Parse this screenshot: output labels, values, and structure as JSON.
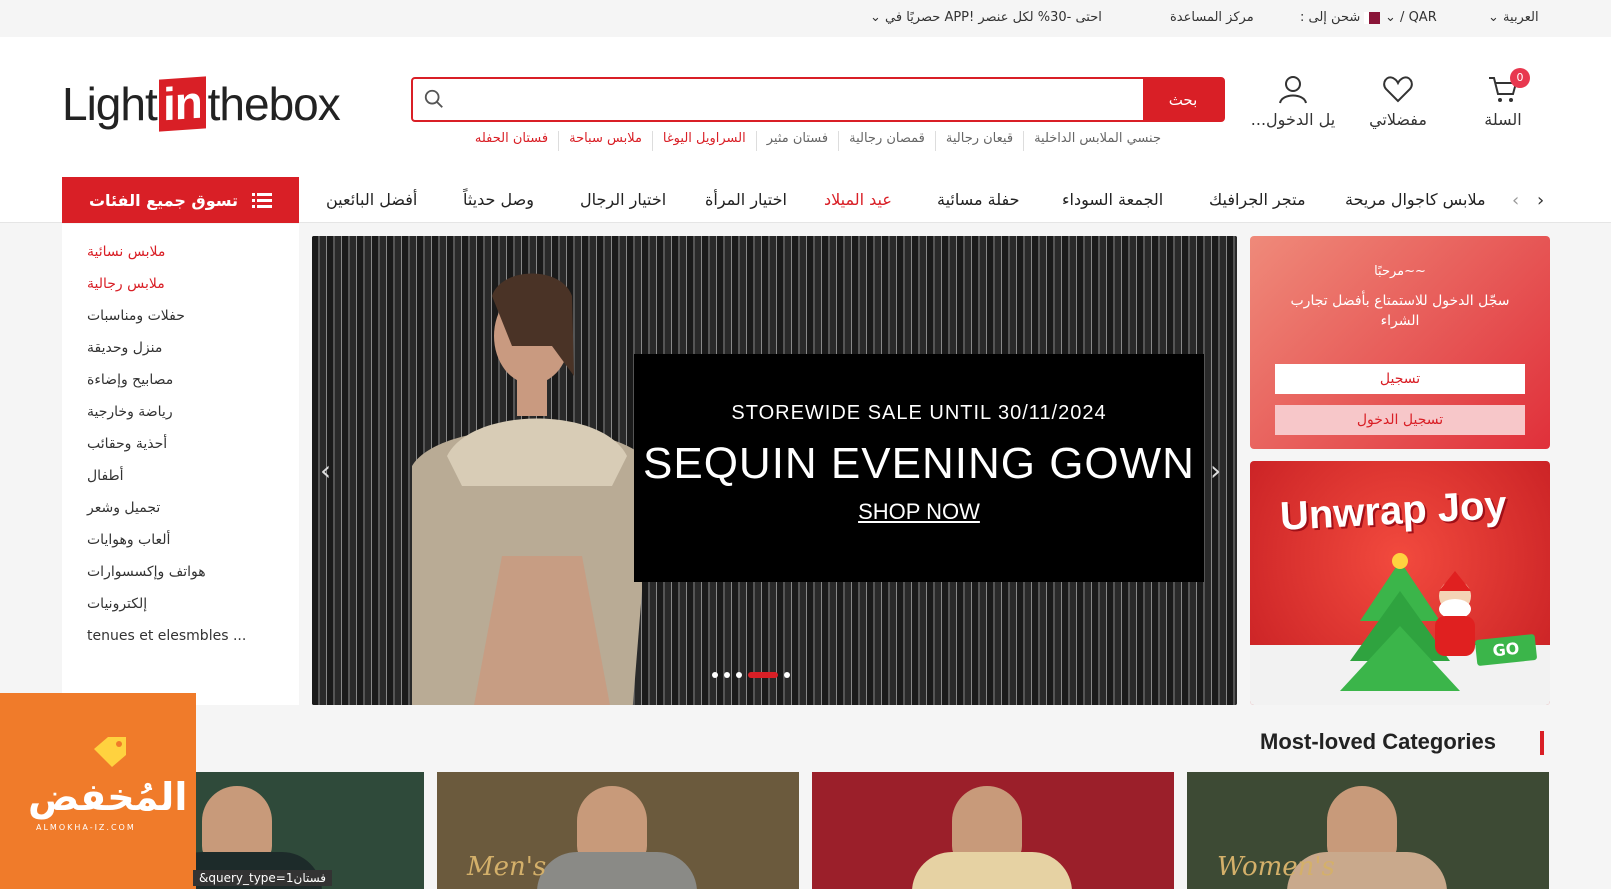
{
  "topbar": {
    "language": "العربية",
    "currency": "QAR",
    "ship_to": "شحن إلى :",
    "help": "مركز المساعدة",
    "app_promo": "احتى -30% لكل عنصر !APP حصريًا في"
  },
  "header": {
    "logo": {
      "light": "Light",
      "in": "in",
      "box": "thebox"
    },
    "search": {
      "placeholder": "",
      "button": "بحث"
    },
    "hotwords": [
      {
        "text": "جنسي الملابس الداخلية",
        "red": false
      },
      {
        "text": "قيعان رجالية",
        "red": false
      },
      {
        "text": "قمصان رجالية",
        "red": false
      },
      {
        "text": "فستان مثير",
        "red": false
      },
      {
        "text": "السراويل اليوغا",
        "red": true
      },
      {
        "text": "ملابس سباحة",
        "red": true
      },
      {
        "text": "فستان الحفله",
        "red": true
      }
    ],
    "signin_label": "...يل الدخول",
    "wishlist_label": "مفضلاتي",
    "cart_label": "السلة",
    "cart_count": "0"
  },
  "nav": {
    "all_categories": "تسوق جميع الفئات",
    "items": [
      {
        "text": "أفضل البائعين",
        "red": false
      },
      {
        "text": "وصل حديثاً",
        "red": false
      },
      {
        "text": "اختيار الرجال",
        "red": false
      },
      {
        "text": "اختيار المرأة",
        "red": false
      },
      {
        "text": "عيد الميلاد",
        "red": true
      },
      {
        "text": "حفلة مسائية",
        "red": false
      },
      {
        "text": "الجمعة السوداء",
        "red": false
      },
      {
        "text": "متجر الجرافيك",
        "red": false
      },
      {
        "text": "ملابس كاجوال مريحة",
        "red": false
      }
    ]
  },
  "sidebar": {
    "items": [
      {
        "text": "ملابس نسائية",
        "red": true
      },
      {
        "text": "ملابس رجالية",
        "red": true
      },
      {
        "text": "حفلات ومناسبات",
        "red": false
      },
      {
        "text": "منزل وحديقة",
        "red": false
      },
      {
        "text": "مصابيح وإضاءة",
        "red": false
      },
      {
        "text": "رياضة وخارجية",
        "red": false
      },
      {
        "text": "أحذية وحقائب",
        "red": false
      },
      {
        "text": "أطفال",
        "red": false
      },
      {
        "text": "تجميل وشعر",
        "red": false
      },
      {
        "text": "ألعاب وهوايات",
        "red": false
      },
      {
        "text": "هواتف وإكسسوارات",
        "red": false
      },
      {
        "text": "إلكترونيات",
        "red": false
      },
      {
        "text": "tenues et elesmbles ...",
        "red": false
      }
    ]
  },
  "banner": {
    "line1": "STOREWIDE SALE UNTIL 30/11/2024",
    "line2": "SEQUIN EVENING GOWN",
    "line3": "SHOP NOW",
    "slides": 5,
    "active_slide": 4
  },
  "welcome": {
    "greeting": "~~مرحبًا",
    "message": "سجّل الدخول للاستمتاع بأفضل تجارب الشراء",
    "register": "تسجيل",
    "login": "تسجيل الدخول"
  },
  "promo": {
    "title": "Unwrap Joy",
    "sign": "GO"
  },
  "categories": {
    "title": "Most-loved Categories",
    "cards": [
      {
        "script": "Women's"
      },
      {
        "script": ""
      },
      {
        "script": "Men's"
      },
      {
        "script": ""
      }
    ]
  },
  "watermark": {
    "text": "المُخفض",
    "sub": "ALMOKHA-IZ.COM"
  },
  "url_hint": "&query_type=1فستان",
  "colors": {
    "brand_red": "#d91f26",
    "watermark_orange": "#f07b2a"
  }
}
